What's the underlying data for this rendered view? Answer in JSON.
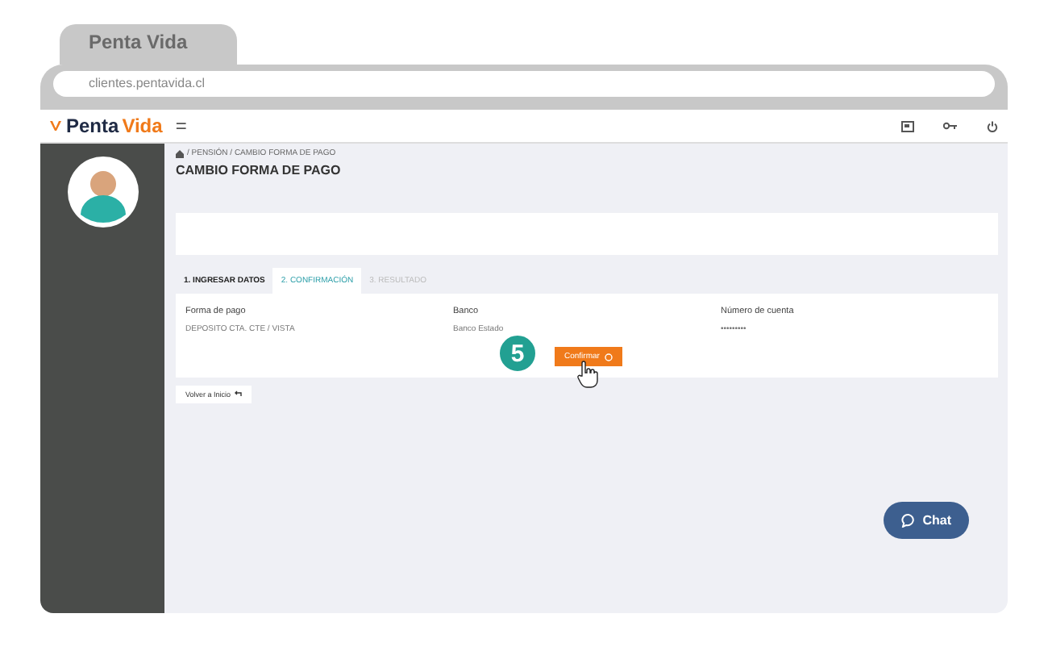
{
  "browser": {
    "tab_title": "Penta Vida",
    "url": "clientes.pentavida.cl"
  },
  "header": {
    "logo_left": "Penta",
    "logo_right": "Vida",
    "menu_glyph": "="
  },
  "breadcrumb": "/ PENSIÓN / CAMBIO FORMA DE PAGO",
  "page_title": "CAMBIO FORMA DE PAGO",
  "steps": [
    {
      "label": "1. INGRESAR DATOS",
      "selected": false,
      "disabled": false
    },
    {
      "label": "2. CONFIRMACIÓN",
      "selected": true,
      "disabled": false
    },
    {
      "label": "3. RESULTADO",
      "selected": false,
      "disabled": true
    }
  ],
  "fields": [
    {
      "label": "Forma de pago",
      "value": "DEPOSITO CTA. CTE / VISTA"
    },
    {
      "label": "Banco",
      "value": "Banco Estado"
    },
    {
      "label": "Número de cuenta",
      "value": "•••••••••"
    }
  ],
  "step_badge": "5",
  "confirm_button": "Confirmar",
  "back_button": "Volver a Inicio",
  "chat_button": "Chat"
}
